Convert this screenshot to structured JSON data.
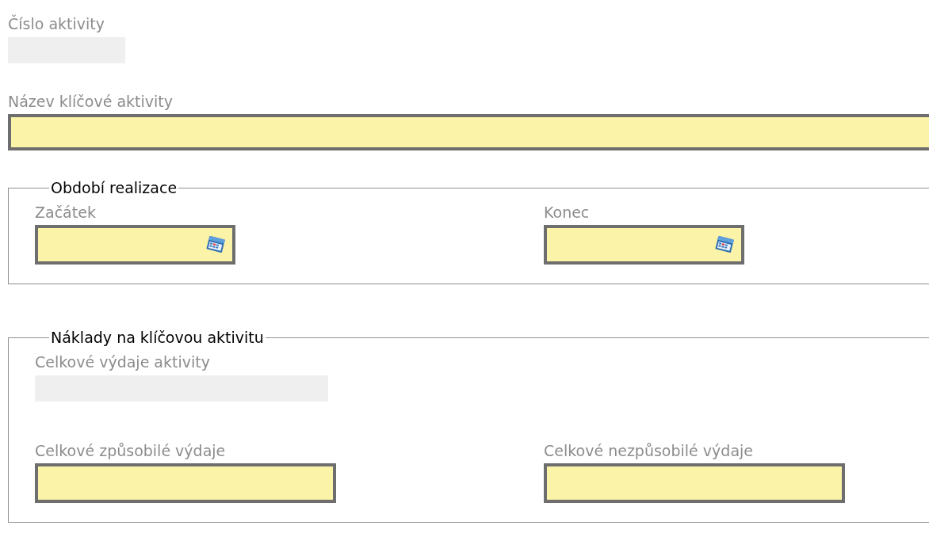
{
  "fields": [
    {
      "label": "Číslo aktivity",
      "kind": "readonly"
    },
    {
      "label": "Název klíčové aktivity",
      "kind": "text"
    }
  ],
  "groups": [
    {
      "legend": "Období realizace",
      "rows": [
        [
          {
            "label": "Začátek",
            "kind": "date"
          },
          {
            "label": "Konec",
            "kind": "date"
          }
        ]
      ]
    },
    {
      "legend": "Náklady na klíčovou aktivitu",
      "rows": [
        [
          {
            "label": "Celkové výdaje aktivity",
            "kind": "readonly"
          }
        ],
        [
          {
            "label": "Celkové způsobilé výdaje",
            "kind": "text"
          },
          {
            "label": "Celkové nezpůsobilé výdaje",
            "kind": "text"
          }
        ]
      ]
    }
  ]
}
